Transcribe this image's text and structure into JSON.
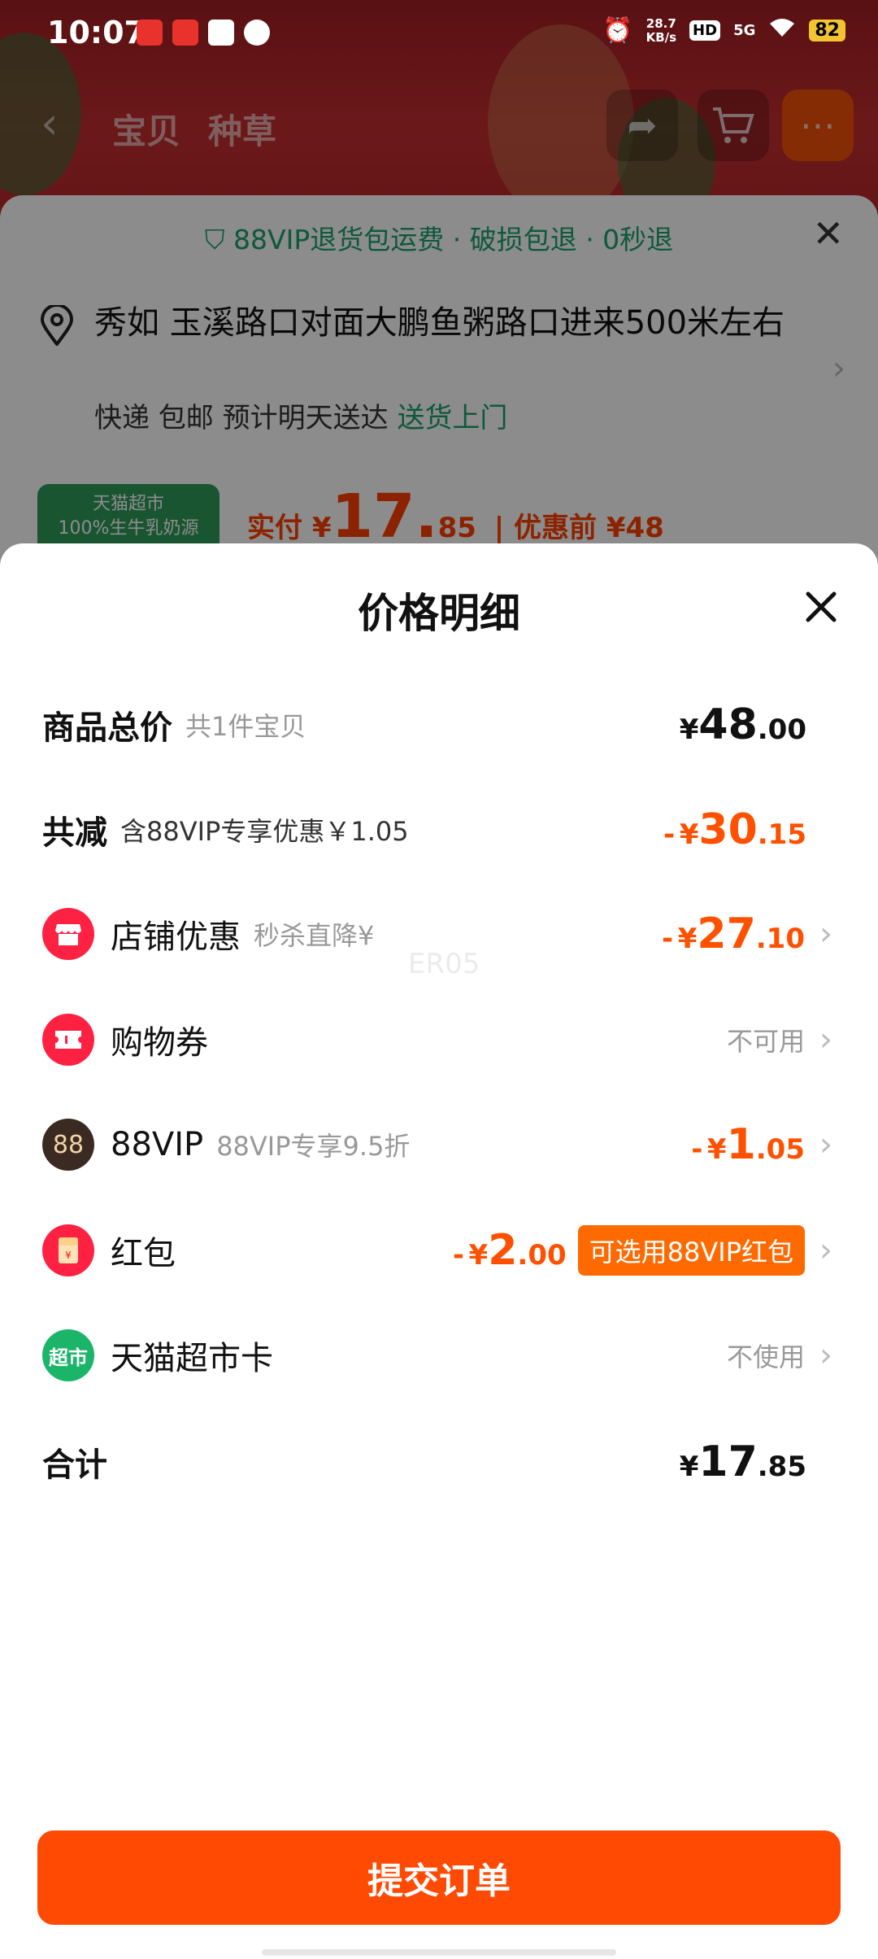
{
  "status": {
    "time": "10:07",
    "net_speed_value": "28.7",
    "net_speed_unit": "KB/s",
    "hd": "HD",
    "signal": "5G",
    "battery": "82"
  },
  "background": {
    "nav_tabs": [
      "宝贝",
      "种草"
    ],
    "guarantee": "88VIP退货包运费 · 破损包退 · 0秒退",
    "address": "秀如 玉溪路口对面大鹏鱼粥路口进来500米左右",
    "delivery_prefix": "快递 包邮 预计明天送达",
    "delivery_highlight": "送货上门",
    "product_thumb_text": "天猫超市\n100%生牛乳奶源",
    "pay_label": "实付 ¥",
    "pay_int": "17.",
    "pay_dec": "85",
    "before_label": "| 优惠前 ¥48"
  },
  "sheet": {
    "title": "价格明细",
    "rows": [
      {
        "label": "商品总价",
        "sub": "共1件宝贝",
        "amount_prefix": "",
        "yen": "¥",
        "int": "48",
        "dec": ".00"
      },
      {
        "label": "共减",
        "sub": "含88VIP专享优惠￥1.05",
        "amount_prefix": "-",
        "yen": "¥",
        "int": "30",
        "dec": ".15"
      },
      {
        "label": "店铺优惠",
        "sub": "秒杀直降¥",
        "amount_prefix": "-",
        "yen": "¥",
        "int": "27",
        "dec": ".10"
      },
      {
        "label": "购物券",
        "status": "不可用"
      },
      {
        "label": "88VIP",
        "sub": "88VIP专享9.5折",
        "amount_prefix": "-",
        "yen": "¥",
        "int": "1",
        "dec": ".05"
      },
      {
        "label": "红包",
        "amount_prefix": "-",
        "yen": "¥",
        "int": "2",
        "dec": ".00",
        "pill": "可选用88VIP红包"
      },
      {
        "label": "天猫超市卡",
        "status": "不使用"
      },
      {
        "label": "合计",
        "amount_prefix": "",
        "yen": "¥",
        "int": "17",
        "dec": ".85"
      }
    ],
    "watermark": "ER05",
    "submit_label": "提交订单"
  },
  "colors": {
    "accent": "#ff4a04",
    "discount": "#ff5000",
    "green": "#1aa06d",
    "shop_icon": "#ff2142",
    "vip_icon": "#3a2a22",
    "supermarket_icon": "#1bb56a"
  },
  "icons": {
    "shop": "shop-icon",
    "coupon": "coupon-icon",
    "vip": "88vip-icon",
    "redpacket": "red-packet-icon",
    "supermarket": "supermarket-card-icon"
  }
}
